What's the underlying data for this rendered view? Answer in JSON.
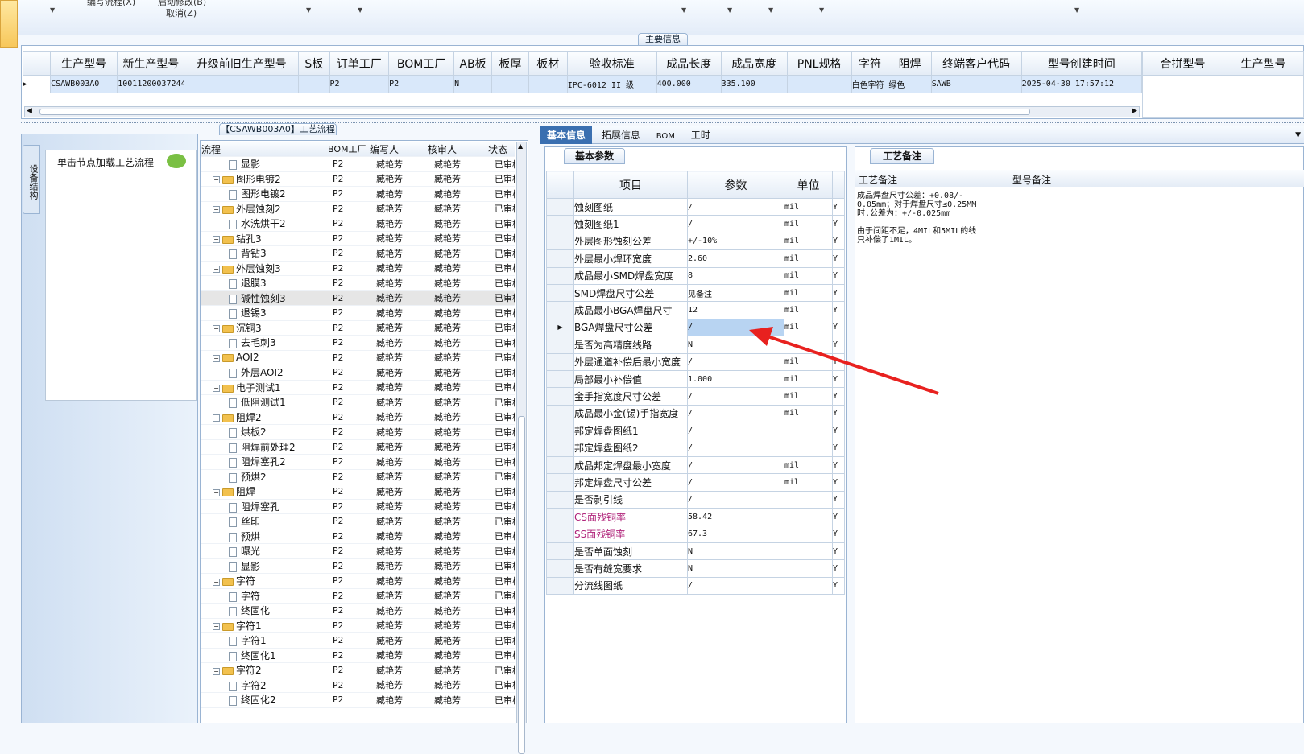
{
  "toolbar": {
    "labels": [
      "编写流程(X)",
      "启动修改(B)",
      "取消(Z)"
    ]
  },
  "main_info": {
    "title": "主要信息",
    "columns": [
      "生产型号",
      "新生产型号",
      "升级前旧生产型号",
      "S板",
      "订单工厂",
      "BOM工厂",
      "AB板",
      "板厚",
      "板材",
      "验收标准",
      "成品长度",
      "成品宽度",
      "PNL规格",
      "字符",
      "阻焊",
      "终端客户代码",
      "型号创建时间"
    ],
    "row": [
      "CSAWB003A0",
      "10011200037244",
      "",
      "",
      "P2",
      "P2",
      "N",
      "",
      "",
      "IPC-6012 II 级",
      "400.000",
      "335.100",
      "",
      "白色字符",
      "绿色",
      "SAWB",
      "2025-04-30 17:57:12"
    ],
    "merge_columns": [
      "合拼型号",
      "生产型号"
    ]
  },
  "side": {
    "vertical_tab": "设备结构",
    "hint": "单击节点加载工艺流程"
  },
  "flow": {
    "title": "【CSAWB003A0】工艺流程",
    "columns": [
      "流程",
      "BOM工厂",
      "编写人",
      "核审人",
      "状态"
    ],
    "rows": [
      {
        "name": "显影",
        "level": 2,
        "f": "P2",
        "w": "臧艳芳",
        "r": "臧艳芳",
        "s": "已审核"
      },
      {
        "name": "图形电镀2",
        "level": 1,
        "f": "P2",
        "w": "臧艳芳",
        "r": "臧艳芳",
        "s": "已审核"
      },
      {
        "name": "图形电镀2",
        "level": 2,
        "f": "P2",
        "w": "臧艳芳",
        "r": "臧艳芳",
        "s": "已审核"
      },
      {
        "name": "外层蚀刻2",
        "level": 1,
        "f": "P2",
        "w": "臧艳芳",
        "r": "臧艳芳",
        "s": "已审核"
      },
      {
        "name": "水洗烘干2",
        "level": 2,
        "f": "P2",
        "w": "臧艳芳",
        "r": "臧艳芳",
        "s": "已审核"
      },
      {
        "name": "钻孔3",
        "level": 1,
        "f": "P2",
        "w": "臧艳芳",
        "r": "臧艳芳",
        "s": "已审核"
      },
      {
        "name": "背钻3",
        "level": 2,
        "f": "P2",
        "w": "臧艳芳",
        "r": "臧艳芳",
        "s": "已审核"
      },
      {
        "name": "外层蚀刻3",
        "level": 1,
        "f": "P2",
        "w": "臧艳芳",
        "r": "臧艳芳",
        "s": "已审核"
      },
      {
        "name": "退膜3",
        "level": 2,
        "f": "P2",
        "w": "臧艳芳",
        "r": "臧艳芳",
        "s": "已审核"
      },
      {
        "name": "碱性蚀刻3",
        "level": 2,
        "f": "P2",
        "w": "臧艳芳",
        "r": "臧艳芳",
        "s": "已审核",
        "sel": true
      },
      {
        "name": "退锡3",
        "level": 2,
        "f": "P2",
        "w": "臧艳芳",
        "r": "臧艳芳",
        "s": "已审核"
      },
      {
        "name": "沉铜3",
        "level": 1,
        "f": "P2",
        "w": "臧艳芳",
        "r": "臧艳芳",
        "s": "已审核"
      },
      {
        "name": "去毛刺3",
        "level": 2,
        "f": "P2",
        "w": "臧艳芳",
        "r": "臧艳芳",
        "s": "已审核"
      },
      {
        "name": "AOI2",
        "level": 1,
        "f": "P2",
        "w": "臧艳芳",
        "r": "臧艳芳",
        "s": "已审核"
      },
      {
        "name": "外层AOI2",
        "level": 2,
        "f": "P2",
        "w": "臧艳芳",
        "r": "臧艳芳",
        "s": "已审核"
      },
      {
        "name": "电子测试1",
        "level": 1,
        "f": "P2",
        "w": "臧艳芳",
        "r": "臧艳芳",
        "s": "已审核"
      },
      {
        "name": "低阻测试1",
        "level": 2,
        "f": "P2",
        "w": "臧艳芳",
        "r": "臧艳芳",
        "s": "已审核"
      },
      {
        "name": "阻焊2",
        "level": 1,
        "f": "P2",
        "w": "臧艳芳",
        "r": "臧艳芳",
        "s": "已审核"
      },
      {
        "name": "烘板2",
        "level": 2,
        "f": "P2",
        "w": "臧艳芳",
        "r": "臧艳芳",
        "s": "已审核"
      },
      {
        "name": "阻焊前处理2",
        "level": 2,
        "f": "P2",
        "w": "臧艳芳",
        "r": "臧艳芳",
        "s": "已审核"
      },
      {
        "name": "阻焊塞孔2",
        "level": 2,
        "f": "P2",
        "w": "臧艳芳",
        "r": "臧艳芳",
        "s": "已审核"
      },
      {
        "name": "预烘2",
        "level": 2,
        "f": "P2",
        "w": "臧艳芳",
        "r": "臧艳芳",
        "s": "已审核"
      },
      {
        "name": "阻焊",
        "level": 1,
        "f": "P2",
        "w": "臧艳芳",
        "r": "臧艳芳",
        "s": "已审核"
      },
      {
        "name": "阻焊塞孔",
        "level": 2,
        "f": "P2",
        "w": "臧艳芳",
        "r": "臧艳芳",
        "s": "已审核"
      },
      {
        "name": "丝印",
        "level": 2,
        "f": "P2",
        "w": "臧艳芳",
        "r": "臧艳芳",
        "s": "已审核"
      },
      {
        "name": "预烘",
        "level": 2,
        "f": "P2",
        "w": "臧艳芳",
        "r": "臧艳芳",
        "s": "已审核"
      },
      {
        "name": "曝光",
        "level": 2,
        "f": "P2",
        "w": "臧艳芳",
        "r": "臧艳芳",
        "s": "已审核"
      },
      {
        "name": "显影",
        "level": 2,
        "f": "P2",
        "w": "臧艳芳",
        "r": "臧艳芳",
        "s": "已审核"
      },
      {
        "name": "字符",
        "level": 1,
        "f": "P2",
        "w": "臧艳芳",
        "r": "臧艳芳",
        "s": "已审核"
      },
      {
        "name": "字符",
        "level": 2,
        "f": "P2",
        "w": "臧艳芳",
        "r": "臧艳芳",
        "s": "已审核"
      },
      {
        "name": "终固化",
        "level": 2,
        "f": "P2",
        "w": "臧艳芳",
        "r": "臧艳芳",
        "s": "已审核"
      },
      {
        "name": "字符1",
        "level": 1,
        "f": "P2",
        "w": "臧艳芳",
        "r": "臧艳芳",
        "s": "已审核"
      },
      {
        "name": "字符1",
        "level": 2,
        "f": "P2",
        "w": "臧艳芳",
        "r": "臧艳芳",
        "s": "已审核"
      },
      {
        "name": "终固化1",
        "level": 2,
        "f": "P2",
        "w": "臧艳芳",
        "r": "臧艳芳",
        "s": "已审核"
      },
      {
        "name": "字符2",
        "level": 1,
        "f": "P2",
        "w": "臧艳芳",
        "r": "臧艳芳",
        "s": "已审核"
      },
      {
        "name": "字符2",
        "level": 2,
        "f": "P2",
        "w": "臧艳芳",
        "r": "臧艳芳",
        "s": "已审核"
      },
      {
        "name": "终固化2",
        "level": 2,
        "f": "P2",
        "w": "臧艳芳",
        "r": "臧艳芳",
        "s": "已审核"
      }
    ]
  },
  "detail": {
    "tabs": [
      "基本信息",
      "拓展信息",
      "BOM",
      "工时"
    ],
    "subtab": "基本参数",
    "columns": [
      "项目",
      "参数",
      "单位"
    ],
    "rows": [
      {
        "item": "蚀刻图纸",
        "val": "/",
        "unit": "mil",
        "flag": "Y"
      },
      {
        "item": "蚀刻图纸1",
        "val": "/",
        "unit": "mil",
        "flag": "Y"
      },
      {
        "item": "外层图形蚀刻公差",
        "val": "+/-10%",
        "unit": "mil",
        "flag": "Y"
      },
      {
        "item": "外层最小焊环宽度",
        "val": "2.60",
        "unit": "mil",
        "flag": "Y"
      },
      {
        "item": "成品最小SMD焊盘宽度",
        "val": "8",
        "unit": "mil",
        "flag": "Y"
      },
      {
        "item": "SMD焊盘尺寸公差",
        "val": "见备注",
        "unit": "mil",
        "flag": "Y"
      },
      {
        "item": "成品最小BGA焊盘尺寸",
        "val": "12",
        "unit": "mil",
        "flag": "Y"
      },
      {
        "item": "BGA焊盘尺寸公差",
        "val": "/",
        "unit": "mil",
        "flag": "Y",
        "sel": true
      },
      {
        "item": "是否为高精度线路",
        "val": "N",
        "unit": "",
        "flag": "Y"
      },
      {
        "item": "外层通道补偿后最小宽度",
        "val": "/",
        "unit": "mil",
        "flag": "Y"
      },
      {
        "item": "局部最小补偿值",
        "val": "1.000",
        "unit": "mil",
        "flag": "Y"
      },
      {
        "item": "金手指宽度尺寸公差",
        "val": "/",
        "unit": "mil",
        "flag": "Y"
      },
      {
        "item": "成品最小金(锡)手指宽度",
        "val": "/",
        "unit": "mil",
        "flag": "Y"
      },
      {
        "item": "邦定焊盘图纸1",
        "val": "/",
        "unit": "",
        "flag": "Y"
      },
      {
        "item": "邦定焊盘图纸2",
        "val": "/",
        "unit": "",
        "flag": "Y"
      },
      {
        "item": "成品邦定焊盘最小宽度",
        "val": "/",
        "unit": "mil",
        "flag": "Y"
      },
      {
        "item": "邦定焊盘尺寸公差",
        "val": "/",
        "unit": "mil",
        "flag": "Y"
      },
      {
        "item": "是否剥引线",
        "val": "/",
        "unit": "",
        "flag": "Y"
      },
      {
        "item": "CS面残铜率",
        "val": "58.42",
        "unit": "",
        "flag": "Y",
        "pink": true
      },
      {
        "item": "SS面残铜率",
        "val": "67.3",
        "unit": "",
        "flag": "Y",
        "pink": true
      },
      {
        "item": "是否单面蚀刻",
        "val": "N",
        "unit": "",
        "flag": "Y"
      },
      {
        "item": "是否有缝宽要求",
        "val": "N",
        "unit": "",
        "flag": "Y"
      },
      {
        "item": "分流线图纸",
        "val": "/",
        "unit": "",
        "flag": "Y"
      }
    ]
  },
  "notes": {
    "tab": "工艺备注",
    "process_label": "工艺备注",
    "model_label": "型号备注",
    "text_lines": [
      "成品焊盘尺寸公差：+0.08/-",
      "0.05mm；对于焊盘尺寸≤0.25MM",
      "时,公差为：+/-0.025mm",
      "",
      "由于间距不足，4MIL和5MIL的线",
      "只补偿了1MIL。"
    ]
  },
  "colors": {
    "accent": "#3a6fb0",
    "select": "#b8d4f2",
    "arrow": "#e8211f",
    "pink": "#b0237a"
  }
}
